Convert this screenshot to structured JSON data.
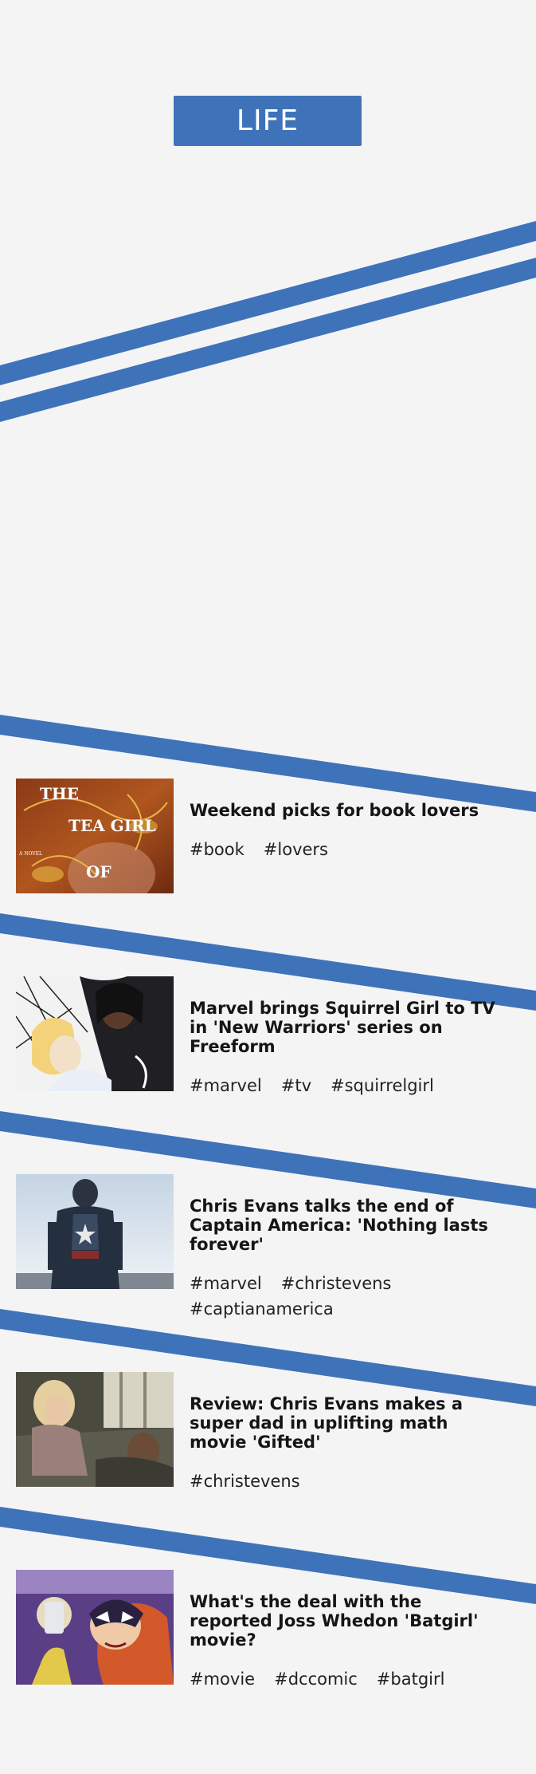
{
  "header": {
    "section_label": "LIFE"
  },
  "colors": {
    "accent": "#3f73b9",
    "background": "#f4f4f5"
  },
  "articles": [
    {
      "title": "Weekend picks for book lovers",
      "tags": [
        "#book",
        "#lovers"
      ],
      "thumbnail": "book-cover-tea-girl-image",
      "thumbnail_text": {
        "line1": "THE",
        "line2": "TEA GIRL",
        "line3": "OF",
        "side": "A NOVEL"
      }
    },
    {
      "title": "Marvel brings Squirrel Girl to TV in 'New Warriors' series on Freeform",
      "tags": [
        "#marvel",
        "#tv",
        "#squirrelgirl"
      ],
      "thumbnail": "cloak-and-dagger-image"
    },
    {
      "title": "Chris Evans talks the end of Captain America: 'Nothing lasts forever'",
      "tags": [
        "#marvel",
        "#christevens",
        "#captianamerica"
      ],
      "thumbnail": "captain-america-image"
    },
    {
      "title": "Review: Chris Evans makes a super dad in uplifting math movie 'Gifted'",
      "tags": [
        "#christevens"
      ],
      "thumbnail": "gifted-movie-still-image"
    },
    {
      "title": "What's the deal with the reported Joss Whedon 'Batgirl' movie?",
      "tags": [
        "#movie",
        "#dccomic",
        "#batgirl"
      ],
      "thumbnail": "batgirl-comic-image"
    }
  ]
}
